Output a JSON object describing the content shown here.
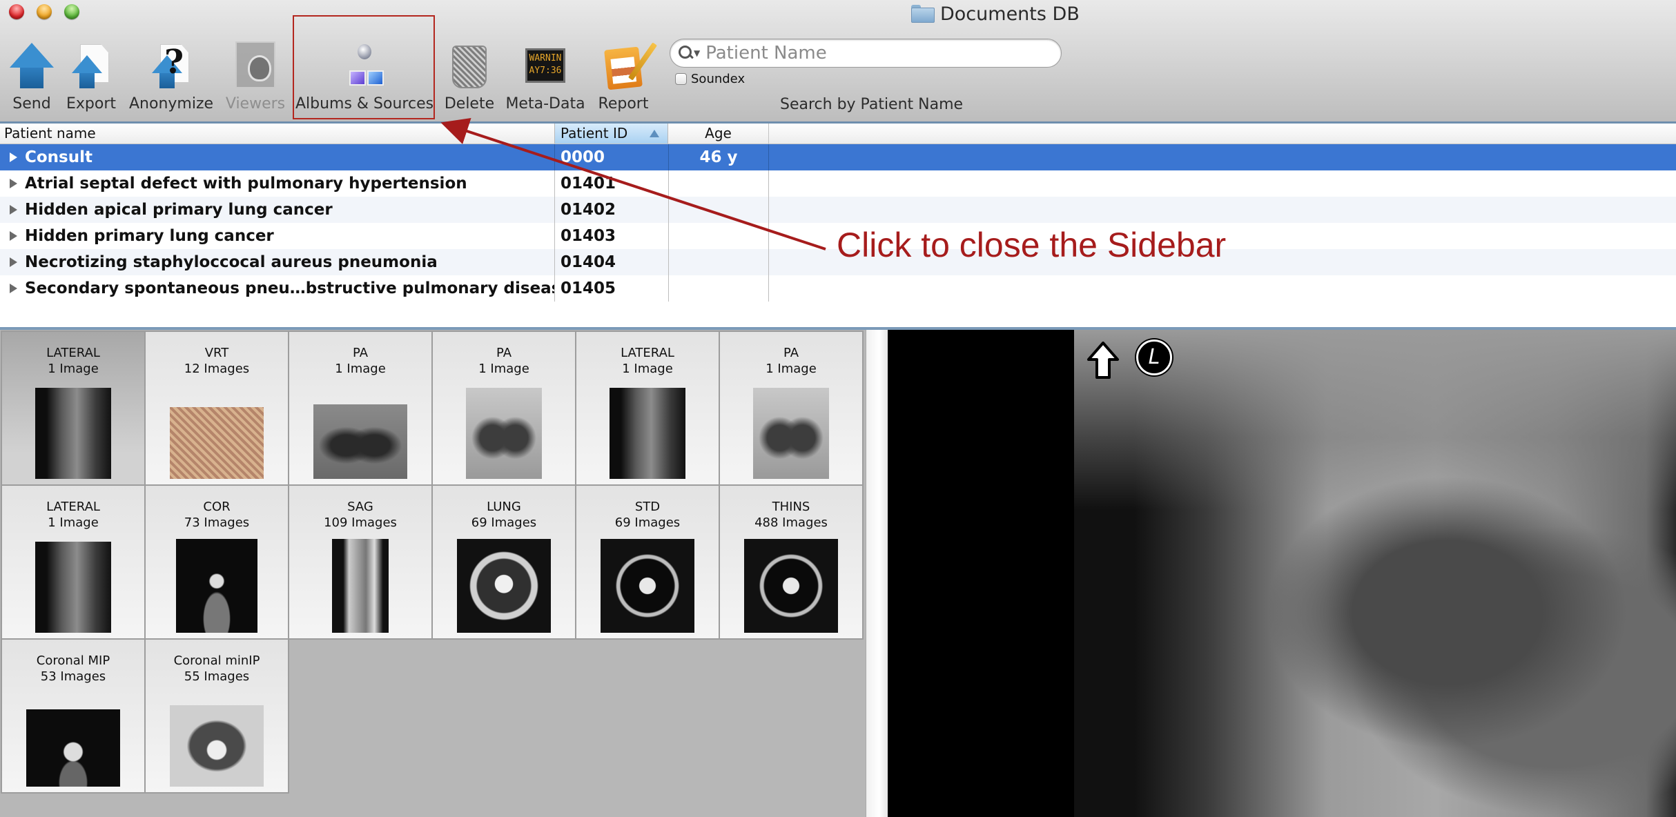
{
  "window": {
    "title": "Documents DB",
    "title_icon": "folder-icon"
  },
  "toolbar": {
    "buttons": [
      {
        "label": "Send",
        "icon": "send-arrow-icon",
        "enabled": true
      },
      {
        "label": "Export",
        "icon": "export-document-icon",
        "enabled": true
      },
      {
        "label": "Anonymize",
        "icon": "anonymize-question-icon",
        "enabled": true
      },
      {
        "label": "Viewers",
        "icon": "viewers-window-icon",
        "enabled": false
      },
      {
        "label": "Albums & Sources",
        "icon": "albums-sources-icon",
        "enabled": true
      },
      {
        "label": "Delete",
        "icon": "trash-icon",
        "enabled": true
      },
      {
        "label": "Meta-Data",
        "icon": "metadata-led-icon",
        "enabled": true
      },
      {
        "label": "Report",
        "icon": "report-pages-icon",
        "enabled": true
      }
    ],
    "metadata_icon_text": [
      "WARNIN",
      "AY7:36"
    ],
    "search": {
      "placeholder": "Patient Name",
      "value": "",
      "soundex_label": "Soundex",
      "soundex_checked": false,
      "caption": "Search by Patient Name"
    }
  },
  "table": {
    "columns": [
      {
        "label": "Patient name"
      },
      {
        "label": "Patient ID",
        "sorted": "ascending"
      },
      {
        "label": "Age"
      }
    ],
    "rows": [
      {
        "name": "Consult",
        "id": "0000",
        "age": "46 y",
        "selected": true
      },
      {
        "name": "Atrial septal defect with pulmonary hypertension",
        "id": "01401",
        "age": ""
      },
      {
        "name": "Hidden apical primary lung cancer",
        "id": "01402",
        "age": ""
      },
      {
        "name": "Hidden primary lung cancer",
        "id": "01403",
        "age": ""
      },
      {
        "name": "Necrotizing staphyloccocal aureus pneumonia",
        "id": "01404",
        "age": ""
      },
      {
        "name": "Secondary spontaneous pneu…bstructive pulmonary disease",
        "id": "01405",
        "age": ""
      }
    ]
  },
  "series": [
    {
      "name": "LATERAL",
      "count": "1 Image",
      "kind": "xray-lat",
      "selected": true
    },
    {
      "name": "VRT",
      "count": "12 Images",
      "kind": "vrt"
    },
    {
      "name": "PA",
      "count": "1 Image",
      "kind": "xray-pa dark"
    },
    {
      "name": "PA",
      "count": "1 Image",
      "kind": "xray-pa"
    },
    {
      "name": "LATERAL",
      "count": "1 Image",
      "kind": "xray-lat"
    },
    {
      "name": "PA",
      "count": "1 Image",
      "kind": "xray-pa"
    },
    {
      "name": "LATERAL",
      "count": "1 Image",
      "kind": "xray-lat"
    },
    {
      "name": "COR",
      "count": "73 Images",
      "kind": "ct-cor"
    },
    {
      "name": "SAG",
      "count": "109 Images",
      "kind": "ct-sag"
    },
    {
      "name": "LUNG",
      "count": "69 Images",
      "kind": "ct-axial lung"
    },
    {
      "name": "STD",
      "count": "69 Images",
      "kind": "ct-axial"
    },
    {
      "name": "THINS",
      "count": "488 Images",
      "kind": "ct-axial"
    },
    {
      "name": "Coronal MIP",
      "count": "53 Images",
      "kind": "cor-mip"
    },
    {
      "name": "Coronal minIP",
      "count": "55 Images",
      "kind": "cor-minip"
    }
  ],
  "viewer": {
    "orientation_marker": "L",
    "orientation_arrow": "up-arrow-icon"
  },
  "annotation": {
    "text": "Click to close the Sidebar",
    "color": "#a61c1c"
  },
  "colors": {
    "selection": "#3b76d2",
    "sorted_header": "#a9d1f1",
    "annotation": "#b3261e"
  }
}
